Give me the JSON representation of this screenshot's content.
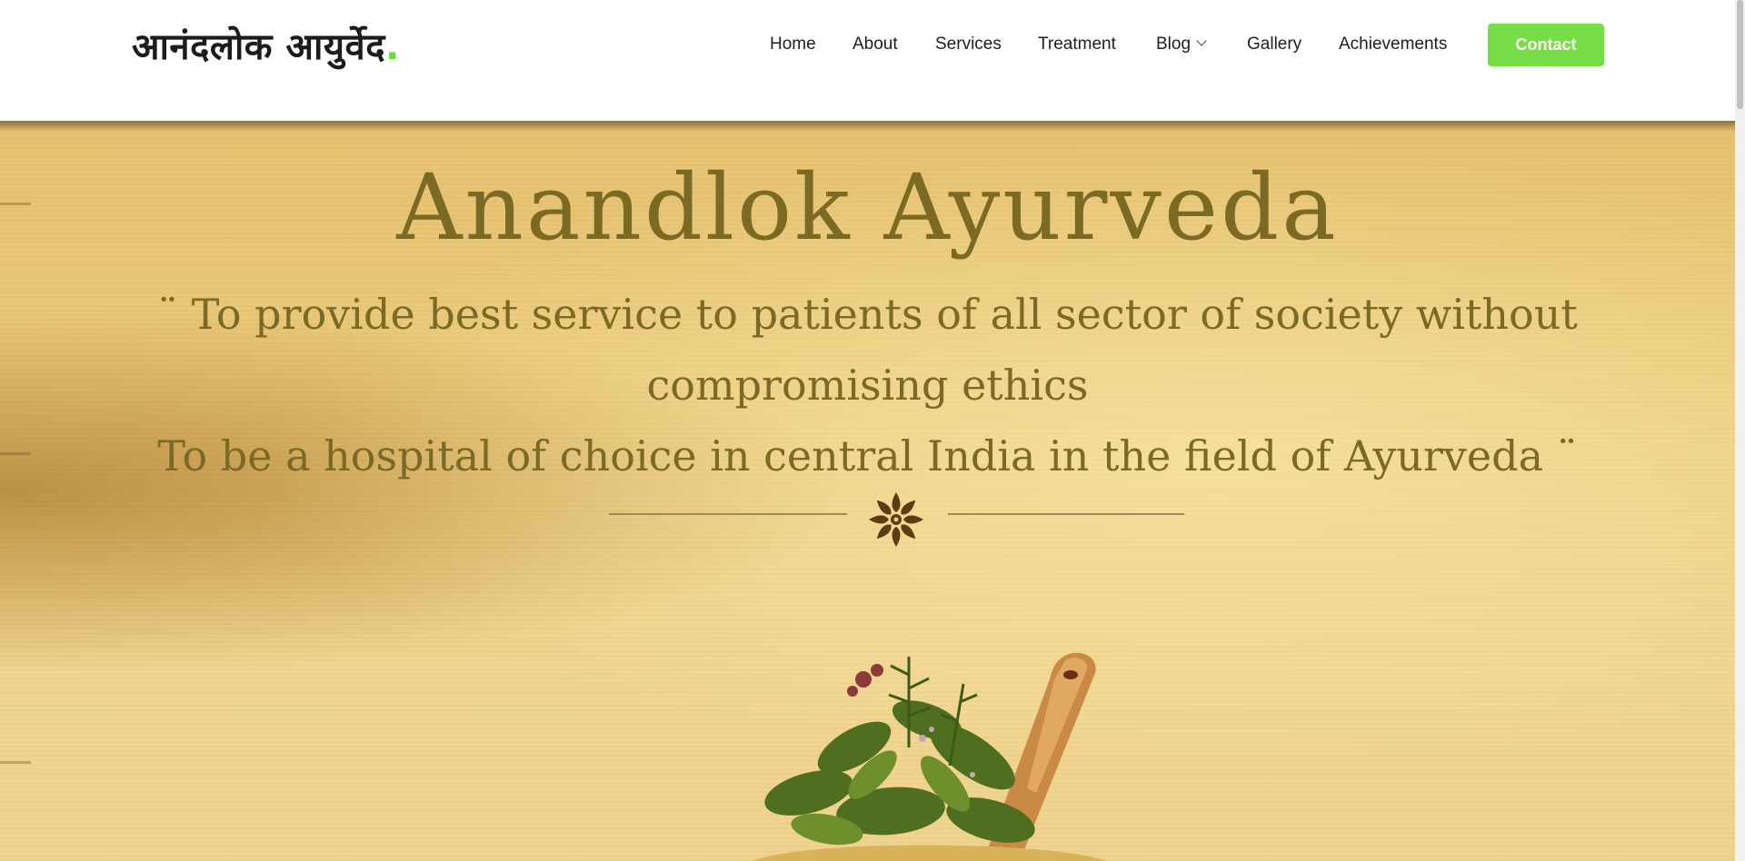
{
  "header": {
    "logo_text": "आनंदलोक आयुर्वेद",
    "logo_dot": "."
  },
  "nav": {
    "items": [
      {
        "label": "Home"
      },
      {
        "label": "About"
      },
      {
        "label": "Services"
      },
      {
        "label": "Treatment"
      },
      {
        "label": "Blog",
        "has_dropdown": true
      },
      {
        "label": "Gallery"
      },
      {
        "label": "Achievements"
      }
    ],
    "contact_label": "Contact"
  },
  "hero": {
    "title": "Anandlok Ayurveda",
    "line1": "¨ To provide best service to patients of all sector of society without",
    "line2": "compromising ethics",
    "line3": "To be a hospital of choice in central India in the field of Ayurveda ¨"
  },
  "colors": {
    "accent": "#77dd45",
    "hero_text": "#7b6a23",
    "parchment": "#ebcb7d"
  },
  "icons": [
    "chevron-down-icon",
    "flower-ornament-icon",
    "herbs-mortar-image"
  ]
}
